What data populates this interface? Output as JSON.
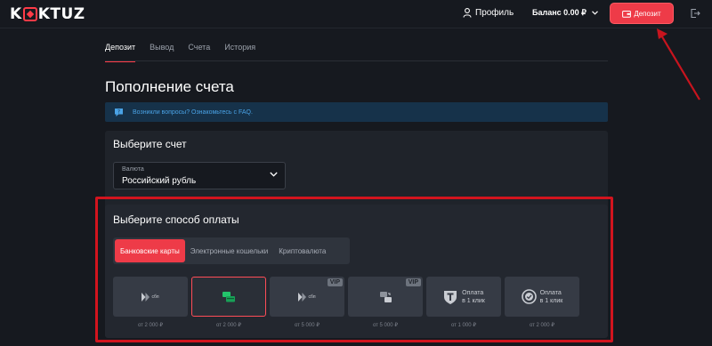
{
  "header": {
    "logo_left": "K",
    "logo_right": "KTUZ",
    "profile_label": "Профиль",
    "balance_label": "Баланс 0.00 ₽",
    "deposit_label": "Депозит"
  },
  "tabs": [
    "Депозит",
    "Вывод",
    "Счета",
    "История"
  ],
  "page_title": "Пополнение счета",
  "faq_text": "Возникли вопросы? Ознакомьтесь с FAQ.",
  "account": {
    "title": "Выберите счет",
    "currency_label": "Валюта",
    "currency_value": "Российский рубль"
  },
  "payment": {
    "title": "Выберите способ оплаты",
    "segments": [
      "Банковские карты",
      "Электронные кошельки",
      "Криптовалюта"
    ],
    "methods": [
      {
        "icon": "sbp-icon",
        "text": "сбп",
        "vip": "",
        "min": "от 2 000 ₽"
      },
      {
        "icon": "card-icon",
        "text": "",
        "vip": "",
        "min": "от 2 000 ₽"
      },
      {
        "icon": "sbp-icon",
        "text": "сбп",
        "vip": "VIP",
        "min": "от 5 000 ₽"
      },
      {
        "icon": "transfer-icon",
        "text": "",
        "vip": "VIP",
        "min": "от 5 000 ₽"
      },
      {
        "icon": "t-bank-icon",
        "text": "Оплата\nв 1 клик",
        "vip": "",
        "min": "от 1 000 ₽"
      },
      {
        "icon": "check-circle-icon",
        "text": "Оплата\nв 1 клик",
        "vip": "",
        "min": "от 2 000 ₽"
      }
    ]
  },
  "colors": {
    "accent": "#ee3b48",
    "background": "#16191f",
    "card": "#1f232a"
  }
}
